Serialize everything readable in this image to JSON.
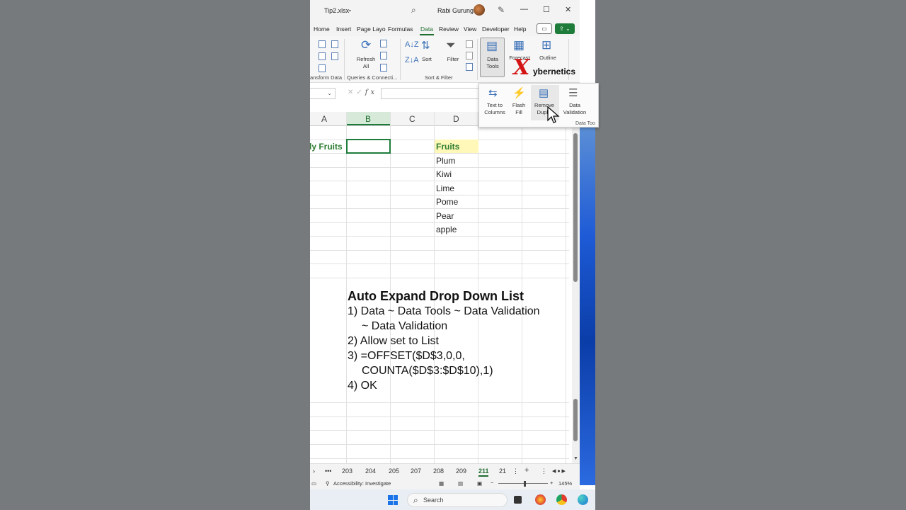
{
  "window": {
    "file_name": "Tip2.xlsx",
    "user_name": "Rabi Gurung"
  },
  "ribbon_tabs": [
    "Home",
    "Insert",
    "Page Layo",
    "Formulas",
    "Data",
    "Review",
    "View",
    "Developer",
    "Help"
  ],
  "active_tab": "Data",
  "ribbon": {
    "refresh_all": "Refresh All",
    "sort": "Sort",
    "filter": "Filter",
    "data_tools": "Data Tools",
    "forecast": "Forecast",
    "outline": "Outline",
    "group_transform": "ansform Data",
    "group_queries": "Queries & Connecti...",
    "group_sort_filter": "Sort & Filter"
  },
  "data_tools_panel": {
    "text_to_columns": "Text to Columns",
    "flash_fill": "Flash Fill",
    "remove_duplicates": "Remove Duplic",
    "data_validation": "Data Validation",
    "group_caption": "Data Too"
  },
  "logo": {
    "mark": "X",
    "text": "ybernetics"
  },
  "formula_bar": {
    "fx": "fx"
  },
  "columns": [
    "A",
    "B",
    "C",
    "D"
  ],
  "cells": {
    "a2": "ly Fruits",
    "d2": "Fruits",
    "fruits": [
      "Plum",
      "Kiwi",
      "Lime",
      "Pome",
      "Pear",
      "apple"
    ]
  },
  "overlay": {
    "title": "Auto Expand Drop Down List",
    "step1": "1) Data ~ Data Tools ~ Data Validation",
    "step1b": "~ Data Validation",
    "step2": "2) Allow set to List",
    "step3": "3) =OFFSET($D$3,0,0,",
    "step3b": "COUNTA($D$3:$D$10),1)",
    "step4": "4) OK"
  },
  "sheet_tabs": [
    "203",
    "204",
    "205",
    "207",
    "208",
    "209",
    "211",
    "21"
  ],
  "active_sheet": "211",
  "status": {
    "accessibility": "Accessibility: Investigate",
    "zoom": "145%"
  },
  "taskbar": {
    "search_placeholder": "Search"
  }
}
